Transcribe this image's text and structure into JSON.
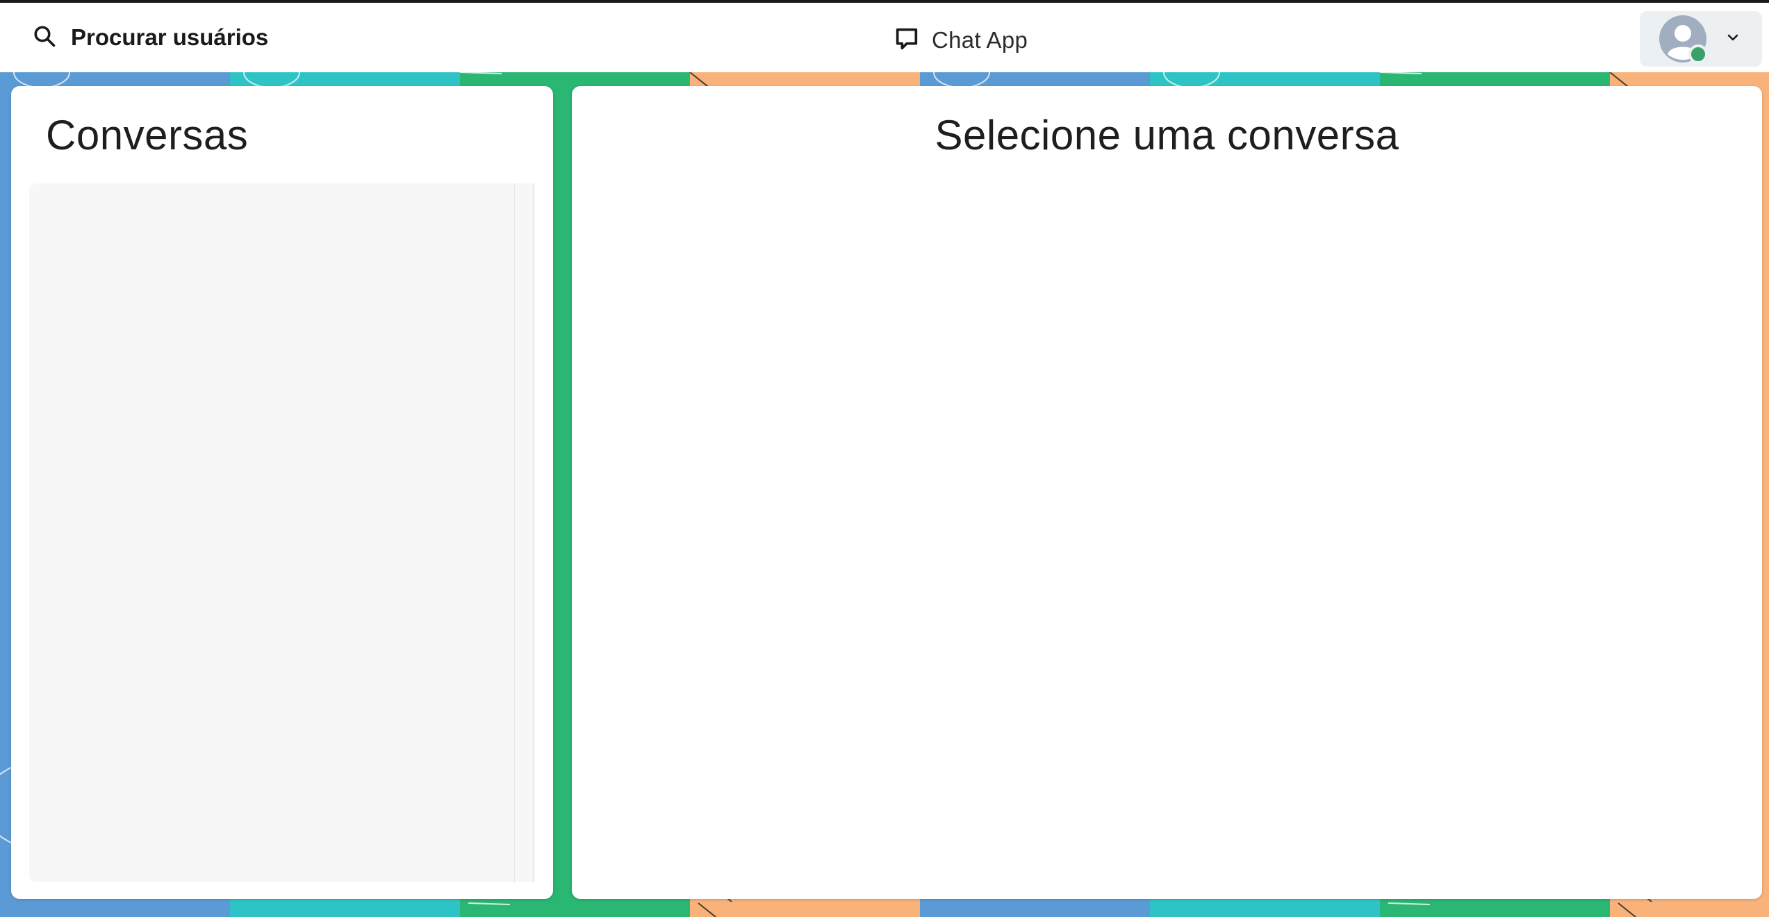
{
  "header": {
    "search_label": "Procurar usuários",
    "brand_title": "Chat App",
    "user_status_color": "#38a169",
    "icons": {
      "search": "search-icon",
      "brand": "chat-bubble-icon",
      "avatar": "user-avatar-icon",
      "menu": "chevron-down-icon"
    }
  },
  "sidebar": {
    "title": "Conversas",
    "items": []
  },
  "chat": {
    "placeholder_title": "Selecione uma conversa"
  },
  "theme": {
    "background_tiles": [
      "#5b9bd5",
      "#2ec4c6",
      "#2ab673",
      "#f9b27a"
    ]
  }
}
